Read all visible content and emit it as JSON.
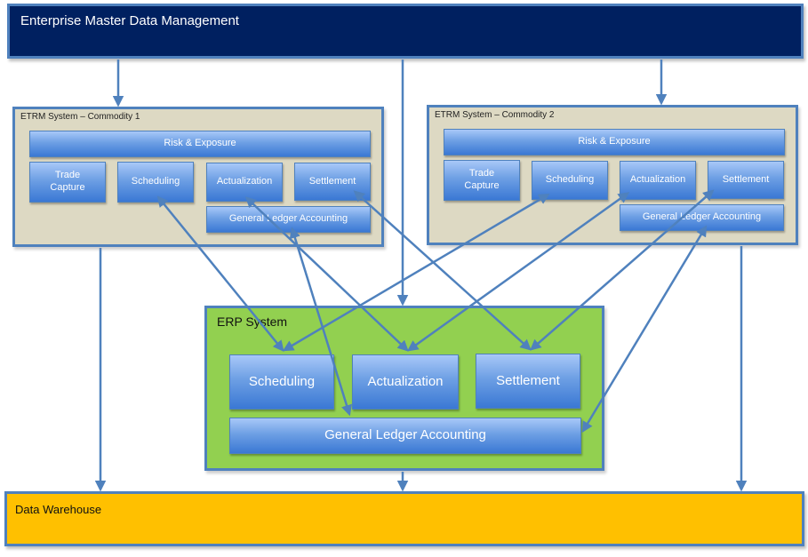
{
  "emdm": {
    "title": "Enterprise Master Data Management"
  },
  "etrm1": {
    "title": "ETRM System – Commodity 1",
    "modules": {
      "risk": "Risk & Exposure",
      "trade_capture": "Trade\nCapture",
      "scheduling": "Scheduling",
      "actualization": "Actualization",
      "settlement": "Settlement",
      "gl": "General Ledger Accounting"
    }
  },
  "etrm2": {
    "title": "ETRM System – Commodity 2",
    "modules": {
      "risk": "Risk & Exposure",
      "trade_capture": "Trade\nCapture",
      "scheduling": "Scheduling",
      "actualization": "Actualization",
      "settlement": "Settlement",
      "gl": "General Ledger Accounting"
    }
  },
  "erp": {
    "title": "ERP System",
    "modules": {
      "scheduling": "Scheduling",
      "actualization": "Actualization",
      "settlement": "Settlement",
      "gl": "General Ledger Accounting"
    }
  },
  "dw": {
    "title": "Data Warehouse"
  },
  "connections": [
    {
      "from": "emdm",
      "to": "etrm1",
      "type": "one-way"
    },
    {
      "from": "emdm",
      "to": "erp",
      "type": "one-way"
    },
    {
      "from": "emdm",
      "to": "etrm2",
      "type": "one-way"
    },
    {
      "from": "etrm1",
      "to": "dw",
      "type": "one-way"
    },
    {
      "from": "erp",
      "to": "dw",
      "type": "one-way"
    },
    {
      "from": "etrm2",
      "to": "dw",
      "type": "one-way"
    },
    {
      "from": "etrm1.scheduling",
      "to": "erp.scheduling",
      "type": "two-way"
    },
    {
      "from": "etrm1.actualization",
      "to": "erp.actualization",
      "type": "two-way"
    },
    {
      "from": "etrm1.settlement",
      "to": "erp.settlement",
      "type": "two-way"
    },
    {
      "from": "etrm1.gl",
      "to": "erp.gl",
      "type": "two-way"
    },
    {
      "from": "etrm2.scheduling",
      "to": "erp.scheduling",
      "type": "two-way"
    },
    {
      "from": "etrm2.actualization",
      "to": "erp.actualization",
      "type": "two-way"
    },
    {
      "from": "etrm2.settlement",
      "to": "erp.settlement",
      "type": "two-way"
    },
    {
      "from": "etrm2.gl",
      "to": "erp.gl",
      "type": "two-way"
    }
  ],
  "colors": {
    "emdm": "#002060",
    "etrm": "#ddd9c3",
    "erp": "#92d050",
    "dw": "#ffc000",
    "border": "#4f81bd",
    "module": "#4f81bd"
  }
}
